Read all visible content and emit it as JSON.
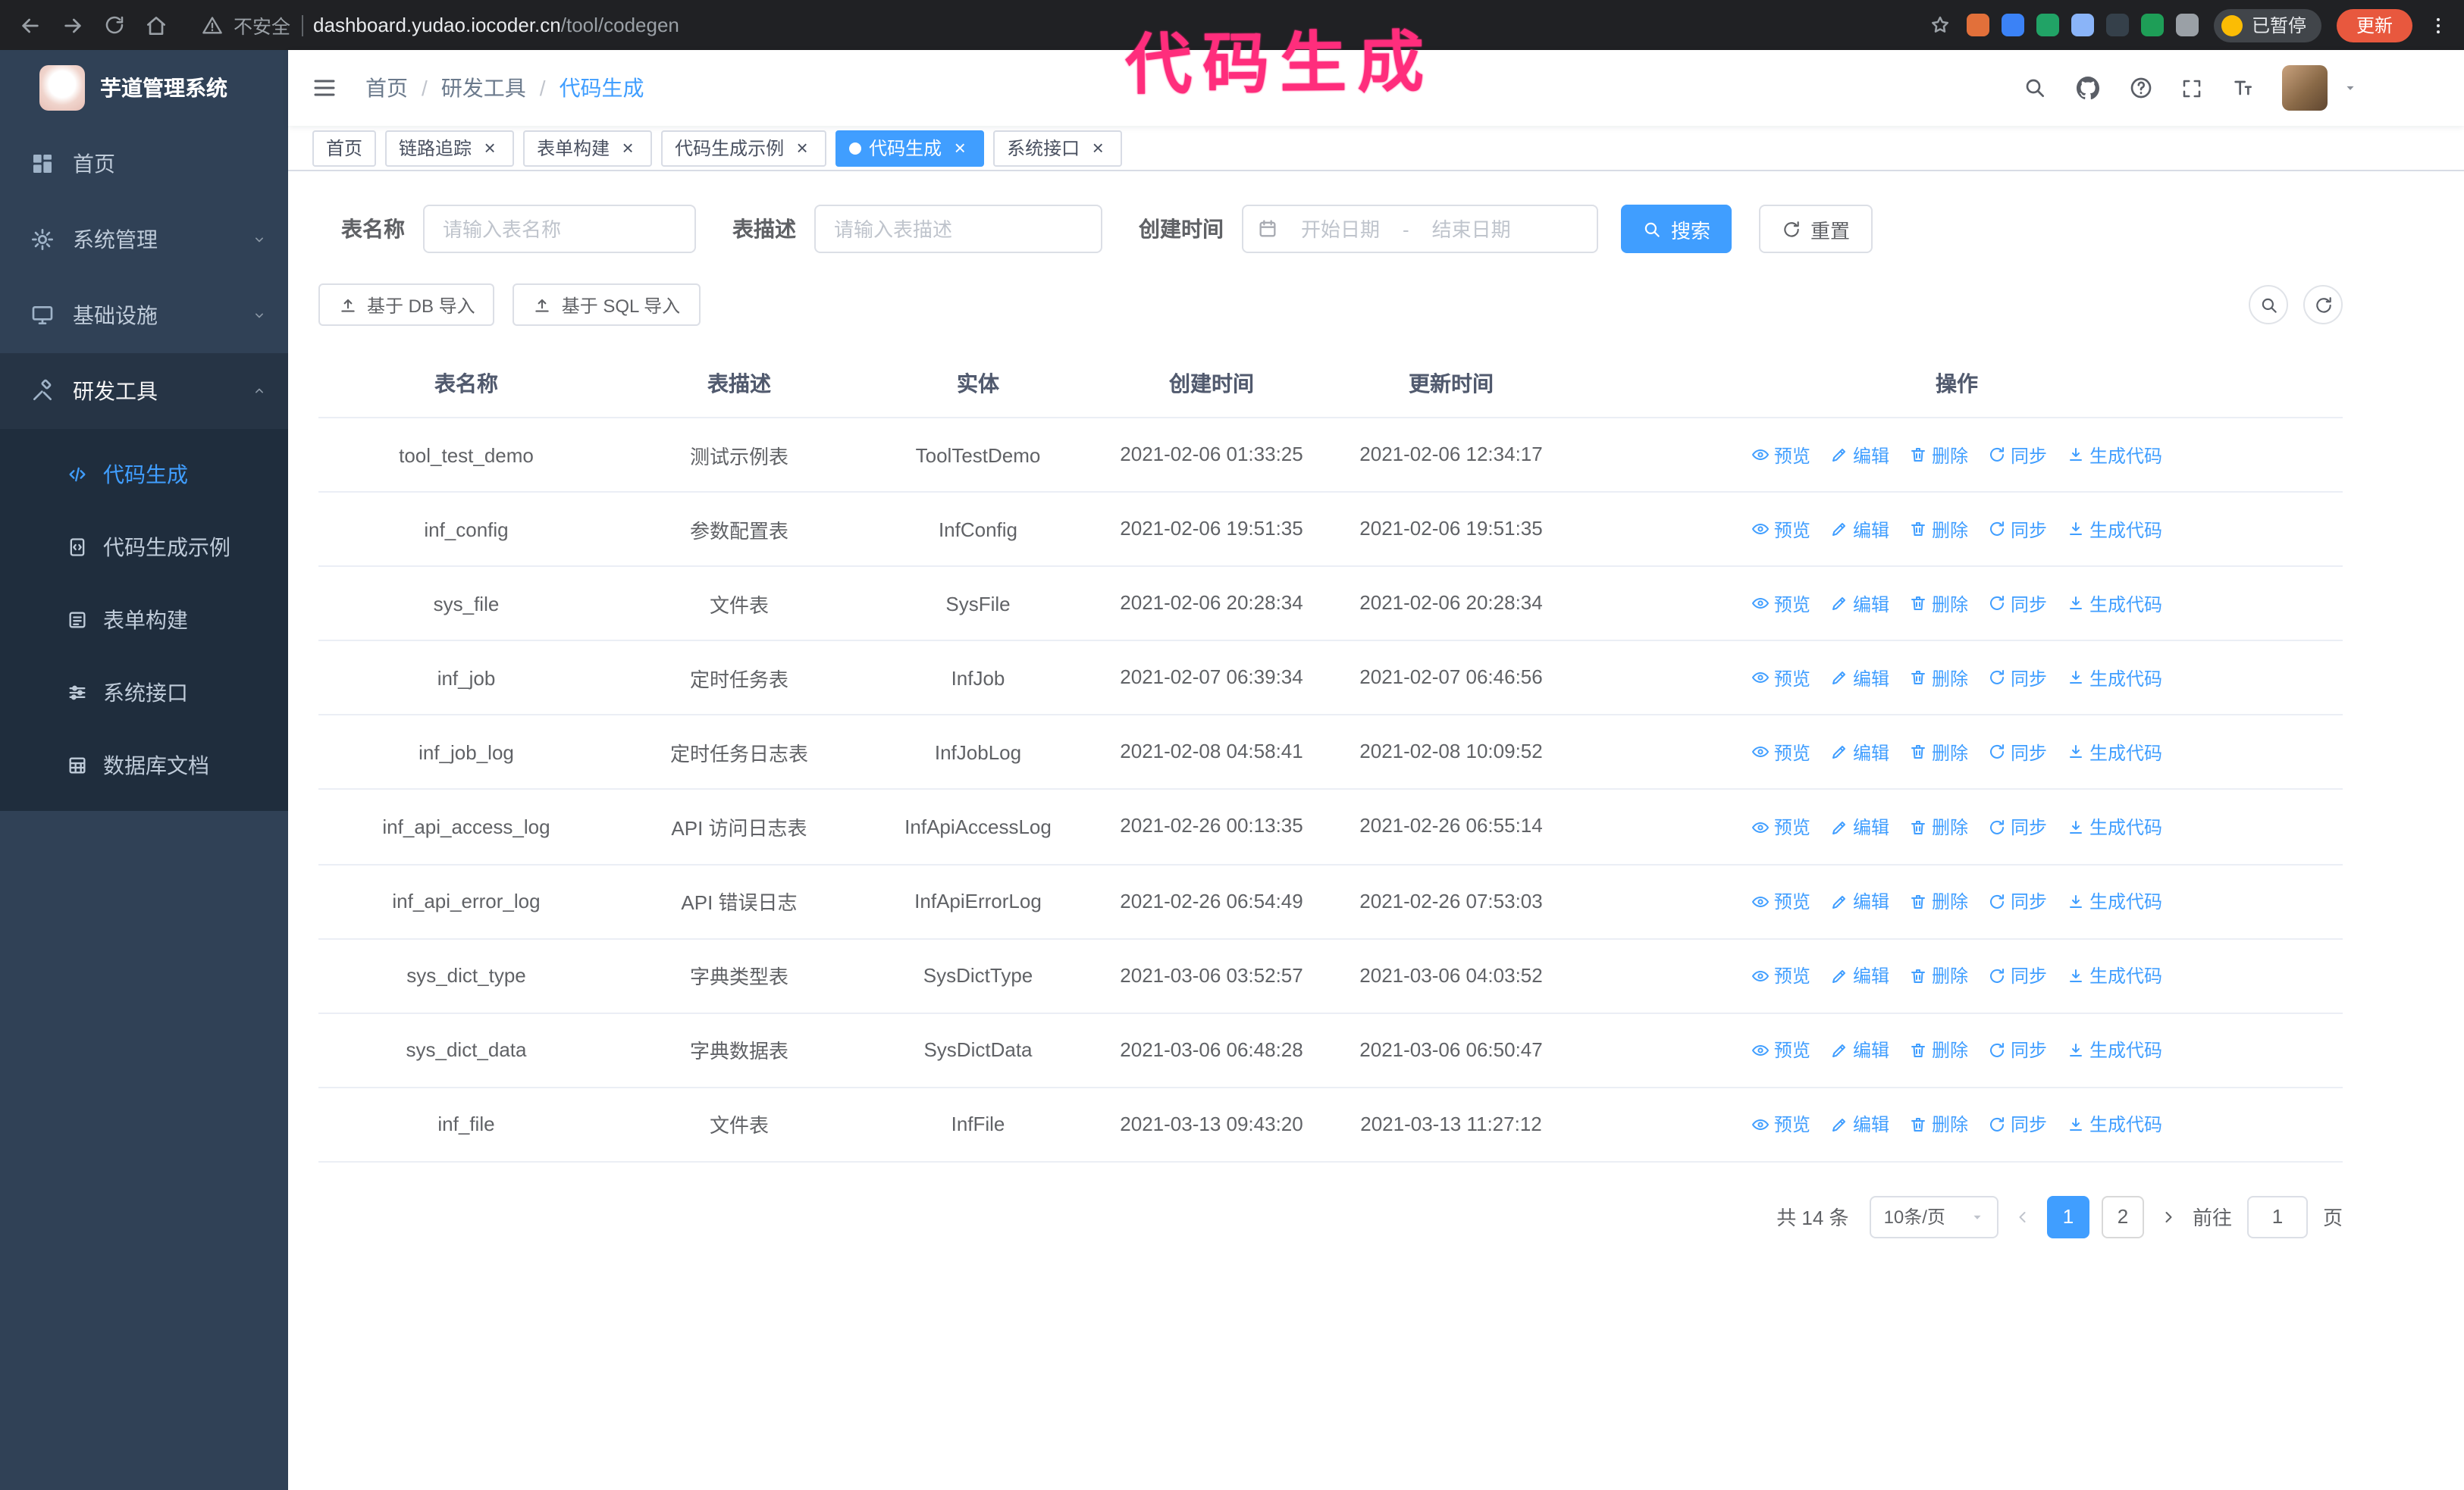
{
  "theme": {
    "accent": "#409eff",
    "sidebar_bg": "#304156",
    "submenu_bg": "#1f2d3d",
    "chrome_bg": "#202124",
    "annotation": "#ff2d7c",
    "update_button_bg": "#e8583e"
  },
  "browser": {
    "security_warning": "不安全",
    "url_domain": "dashboard.yudao.iocoder.cn",
    "url_path": "/tool/codegen",
    "paused_badge": "已暂停",
    "update_button": "更新",
    "extensions": [
      {
        "name": "fox-extension-icon",
        "color": "#e2703a"
      },
      {
        "name": "drop-extension-icon",
        "color": "#3b82f6"
      },
      {
        "name": "v-badge-extension-icon",
        "color": "#21a366"
      },
      {
        "name": "people-extension-icon",
        "color": "#8ab4f8"
      },
      {
        "name": "capture-extension-icon",
        "color": "#35404a"
      },
      {
        "name": "leaf-extension-icon",
        "color": "#1e9e57"
      },
      {
        "name": "puzzle-extension-icon",
        "color": "#9aa0a6"
      }
    ]
  },
  "annotation": {
    "text": "代码生成"
  },
  "sidebar": {
    "app_title": "芋道管理系统",
    "items": [
      {
        "name": "home",
        "label": "首页",
        "icon": "dashboard-icon"
      },
      {
        "name": "system",
        "label": "系统管理",
        "icon": "gear-icon",
        "chevron": "down"
      },
      {
        "name": "infra",
        "label": "基础设施",
        "icon": "monitor-icon",
        "chevron": "down"
      },
      {
        "name": "devtools",
        "label": "研发工具",
        "icon": "tools-icon",
        "chevron": "up",
        "expanded": true
      }
    ],
    "subitems": [
      {
        "name": "codegen",
        "label": "代码生成",
        "icon": "code-icon",
        "active": true
      },
      {
        "name": "codegen-example",
        "label": "代码生成示例",
        "icon": "example-icon"
      },
      {
        "name": "form-builder",
        "label": "表单构建",
        "icon": "form-icon"
      },
      {
        "name": "system-api",
        "label": "系统接口",
        "icon": "api-icon"
      },
      {
        "name": "db-doc",
        "label": "数据库文档",
        "icon": "db-doc-icon"
      }
    ]
  },
  "header": {
    "breadcrumb": [
      "首页",
      "研发工具",
      "代码生成"
    ]
  },
  "tabs": [
    {
      "name": "home",
      "label": "首页",
      "closable": false,
      "active": false
    },
    {
      "name": "trace",
      "label": "链路追踪",
      "closable": true,
      "active": false
    },
    {
      "name": "form-builder",
      "label": "表单构建",
      "closable": true,
      "active": false
    },
    {
      "name": "codegen-example",
      "label": "代码生成示例",
      "closable": true,
      "active": false
    },
    {
      "name": "codegen",
      "label": "代码生成",
      "closable": true,
      "active": true
    },
    {
      "name": "system-api",
      "label": "系统接口",
      "closable": true,
      "active": false
    }
  ],
  "filters": {
    "table_name_label": "表名称",
    "table_name_placeholder": "请输入表名称",
    "table_desc_label": "表描述",
    "table_desc_placeholder": "请输入表描述",
    "create_time_label": "创建时间",
    "start_placeholder": "开始日期",
    "range_separator": "-",
    "end_placeholder": "结束日期",
    "search_button": "搜索",
    "reset_button": "重置"
  },
  "toolbar": {
    "import_db": "基于 DB 导入",
    "import_sql": "基于 SQL 导入"
  },
  "table": {
    "columns": [
      "表名称",
      "表描述",
      "实体",
      "创建时间",
      "更新时间",
      "操作"
    ],
    "actions": [
      "预览",
      "编辑",
      "删除",
      "同步",
      "生成代码"
    ],
    "rows": [
      {
        "name": "tool_test_demo",
        "desc": "测试示例表",
        "entity": "ToolTestDemo",
        "created": "2021-02-06 01:33:25",
        "updated": "2021-02-06 12:34:17"
      },
      {
        "name": "inf_config",
        "desc": "参数配置表",
        "entity": "InfConfig",
        "created": "2021-02-06 19:51:35",
        "updated": "2021-02-06 19:51:35"
      },
      {
        "name": "sys_file",
        "desc": "文件表",
        "entity": "SysFile",
        "created": "2021-02-06 20:28:34",
        "updated": "2021-02-06 20:28:34"
      },
      {
        "name": "inf_job",
        "desc": "定时任务表",
        "entity": "InfJob",
        "created": "2021-02-07 06:39:34",
        "updated": "2021-02-07 06:46:56"
      },
      {
        "name": "inf_job_log",
        "desc": "定时任务日志表",
        "entity": "InfJobLog",
        "created": "2021-02-08 04:58:41",
        "updated": "2021-02-08 10:09:52"
      },
      {
        "name": "inf_api_access_log",
        "desc": "API 访问日志表",
        "entity": "InfApiAccessLog",
        "created": "2021-02-26 00:13:35",
        "updated": "2021-02-26 06:55:14"
      },
      {
        "name": "inf_api_error_log",
        "desc": "API 错误日志",
        "entity": "InfApiErrorLog",
        "created": "2021-02-26 06:54:49",
        "updated": "2021-02-26 07:53:03"
      },
      {
        "name": "sys_dict_type",
        "desc": "字典类型表",
        "entity": "SysDictType",
        "created": "2021-03-06 03:52:57",
        "updated": "2021-03-06 04:03:52"
      },
      {
        "name": "sys_dict_data",
        "desc": "字典数据表",
        "entity": "SysDictData",
        "created": "2021-03-06 06:48:28",
        "updated": "2021-03-06 06:50:47"
      },
      {
        "name": "inf_file",
        "desc": "文件表",
        "entity": "InfFile",
        "created": "2021-03-13 09:43:20",
        "updated": "2021-03-13 11:27:12"
      }
    ]
  },
  "pagination": {
    "total_text": "共 14 条",
    "page_size": "10条/页",
    "pages": [
      {
        "label": "1",
        "active": true
      },
      {
        "label": "2",
        "active": false
      }
    ],
    "goto_label": "前往",
    "goto_value": "1",
    "page_suffix": "页"
  }
}
